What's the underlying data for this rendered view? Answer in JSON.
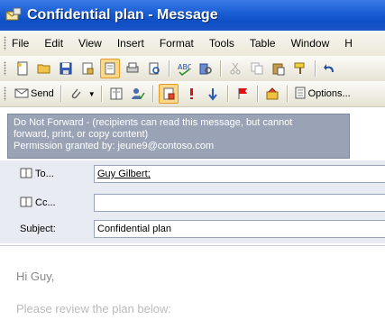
{
  "window": {
    "title": "Confidential plan - Message"
  },
  "menu": [
    "File",
    "Edit",
    "View",
    "Insert",
    "Format",
    "Tools",
    "Table",
    "Window",
    "H"
  ],
  "toolbar2": {
    "send_label": "Send",
    "options_label": "Options..."
  },
  "banner": {
    "line1": "Do Not Forward - (recipients can read this message, but cannot",
    "line2": "forward, print, or copy content)",
    "line3": "Permission granted by: jeune9@contoso.com"
  },
  "headers": {
    "to_label": "To...",
    "to_value": "Guy Gilbert;",
    "cc_label": "Cc...",
    "cc_value": "",
    "subject_label": "Subject:",
    "subject_value": "Confidential plan"
  },
  "body": {
    "greeting": "Hi Guy,",
    "line2": "Please review the plan below:"
  }
}
